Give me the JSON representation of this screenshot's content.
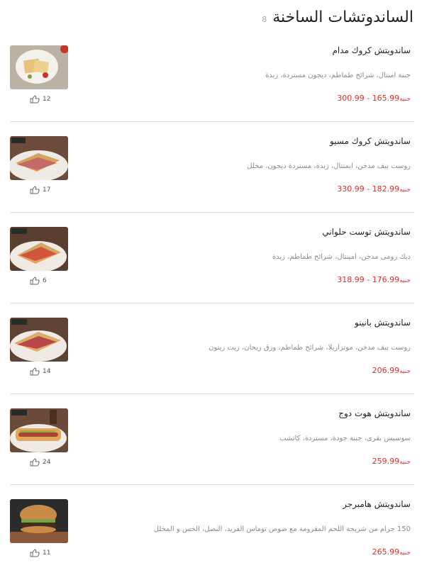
{
  "header": {
    "title": "الساندوتشات الساخنة",
    "count": "8"
  },
  "items": [
    {
      "name": "ساندويتش كروك مدام",
      "desc": "جبنة امنتال، شرائح طماطم، ديجون مستردة، زبدة",
      "price": "165.99 - 300.99",
      "currency": "جنيه",
      "likes": "12"
    },
    {
      "name": "ساندويتش كروك مسيو",
      "desc": "روست بيف مدخن، ايمنتال، زبدة، مستردة ديجون، مخلل",
      "price": "182.99 - 330.99",
      "currency": "جنيه",
      "likes": "17"
    },
    {
      "name": "ساندويتش توست حلواني",
      "desc": "ديك رومى مدخن، امينتال، شرائح طماطم، زبدة",
      "price": "176.99 - 318.99",
      "currency": "جنيه",
      "likes": "6"
    },
    {
      "name": "ساندويتش بانينو",
      "desc": "روست بيف مدخن، موتزاريلا، شرائح طماطم، ورق ريحان، زيت زيتون",
      "price": "206.99",
      "currency": "جنيه",
      "likes": "14"
    },
    {
      "name": "ساندويتش هوت دوج",
      "desc": "سوسيس بقرى، جبنة جودة، مستردة، كاتشب",
      "price": "259.99",
      "currency": "جنيه",
      "likes": "24"
    },
    {
      "name": "ساندويتش هامبرجر",
      "desc": "150 جرام من شريحة اللحم المفرومة مع صوص توماس الفريد، البصل، الخس و المخلل",
      "price": "265.99",
      "currency": "جنيه",
      "likes": "11"
    }
  ],
  "icons": {
    "like": "thumbs-up-icon"
  },
  "colors": {
    "price": "#d93025",
    "divider": "#e2e2e2"
  }
}
